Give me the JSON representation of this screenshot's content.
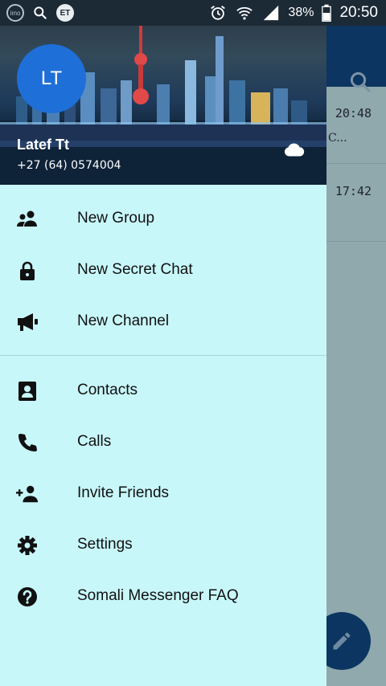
{
  "status_bar": {
    "left_icons": [
      "imo-icon",
      "search-icon",
      "et-icon"
    ],
    "et_label": "ET",
    "imo_label": "imo",
    "right_icons": [
      "alarm-icon",
      "wifi-icon",
      "signal-icon",
      "battery-icon"
    ],
    "battery": "38%",
    "time": "20:50"
  },
  "background_chats": {
    "times": [
      "20:48",
      "17:42"
    ],
    "preview": "C..."
  },
  "drawer": {
    "avatar_initials": "LT",
    "user_name": "Latef Tt",
    "user_phone": "+27 (64) 0574004",
    "menu_group_1": [
      {
        "label": "New Group",
        "icon": "group-icon"
      },
      {
        "label": "New Secret Chat",
        "icon": "lock-icon"
      },
      {
        "label": "New Channel",
        "icon": "megaphone-icon"
      }
    ],
    "menu_group_2": [
      {
        "label": "Contacts",
        "icon": "contact-icon"
      },
      {
        "label": "Calls",
        "icon": "phone-icon"
      },
      {
        "label": "Invite Friends",
        "icon": "add-person-icon"
      },
      {
        "label": "Settings",
        "icon": "gear-icon"
      },
      {
        "label": "Somali Messenger FAQ",
        "icon": "help-icon"
      }
    ]
  },
  "colors": {
    "drawer_bg": "#c8f7fa",
    "appbar": "#0c3561",
    "avatar": "#1f6fd8"
  }
}
